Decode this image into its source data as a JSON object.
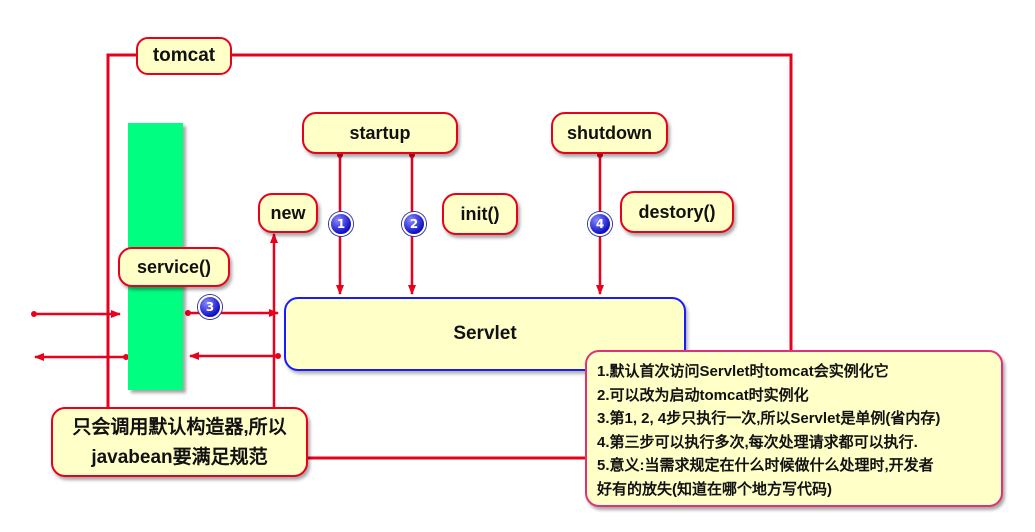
{
  "container": {
    "label": "tomcat"
  },
  "servlet": {
    "label": "Servlet"
  },
  "lifecycle": {
    "startup": "startup",
    "shutdown": "shutdown",
    "new": "new",
    "init": "init()",
    "destroy": "destory()",
    "service": "service()"
  },
  "steps": [
    "1",
    "2",
    "3",
    "4"
  ],
  "notes": {
    "left": [
      "只会调用默认构造器,所以",
      "javabean要满足规范"
    ],
    "right": [
      "1.默认首次访问Servlet时tomcat会实例化它",
      "2.可以改为启动tomcat时实例化",
      "3.第1, 2, 4步只执行一次,所以Servlet是单例(省内存)",
      "4.第三步可以执行多次,每次处理请求都可以执行.",
      "5.意义:当需求规定在什么时候做什么处理时,开发者",
      "好有的放失(知道在哪个地方写代码)"
    ]
  },
  "colors": {
    "line": "#e8001c",
    "servlet_border": "#1a1aff",
    "box_fill": "#ffffc8",
    "green_bar": "#00ff80",
    "badge": "#1010c8"
  }
}
